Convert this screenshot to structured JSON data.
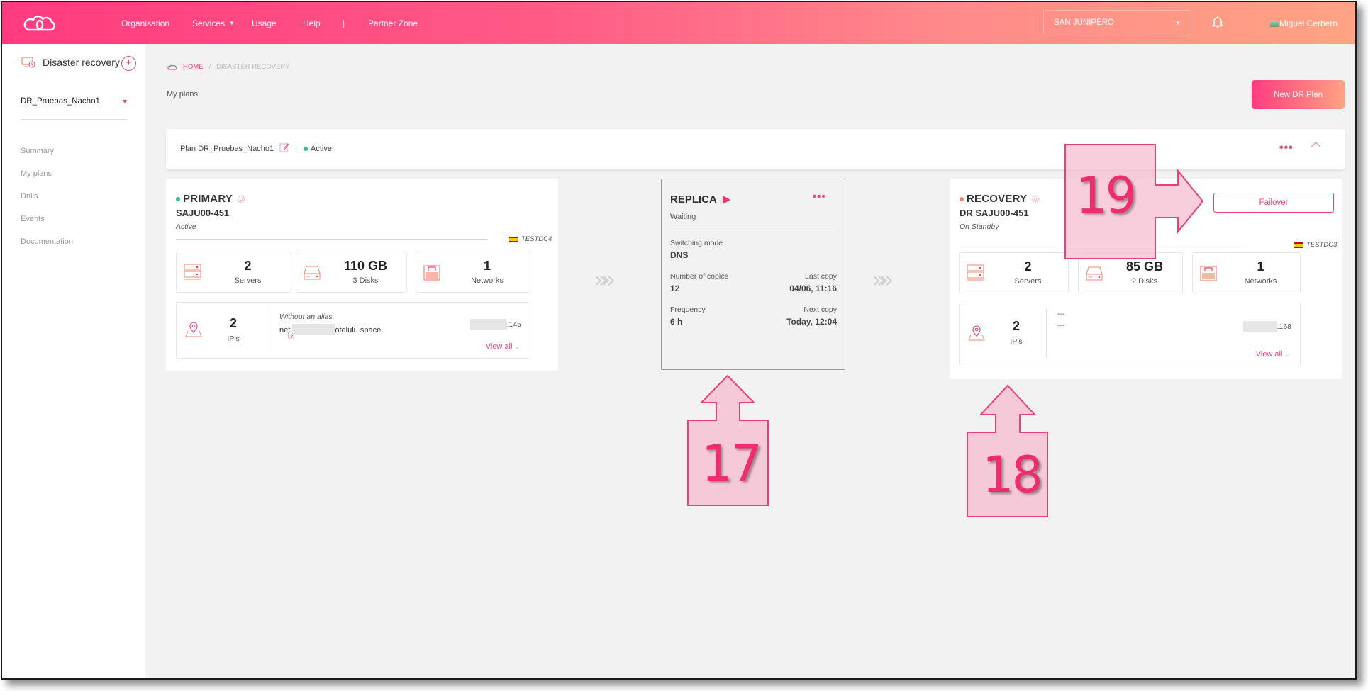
{
  "header": {
    "nav": [
      "Organisation",
      "Services",
      "Usage",
      "Help",
      "|",
      "Partner Zone"
    ],
    "region": "SAN JUNIPERO",
    "user": "Miguel Cerbern",
    "icons": {
      "logo": "cloud-logo-icon",
      "bell": "bell-icon"
    }
  },
  "sidebar": {
    "title": "Disaster recovery",
    "add_label": "+",
    "selected_plan": "DR_Pruebas_Nacho1",
    "items": [
      {
        "label": "Summary"
      },
      {
        "label": "My plans"
      },
      {
        "label": "Drills"
      },
      {
        "label": "Events"
      },
      {
        "label": "Documentation"
      }
    ]
  },
  "breadcrumb": {
    "home": "HOME",
    "separator": "/",
    "current": "DISASTER RECOVERY"
  },
  "page": {
    "subtitle": "My plans",
    "new_plan_label": "New DR Plan"
  },
  "plan": {
    "name": "Plan DR_Pruebas_Nacho1",
    "separator": "|",
    "status": "Active",
    "status_color": "#2ec27e",
    "more_label": "•••"
  },
  "primary": {
    "title": "PRIMARY",
    "status_color": "#2ec27e",
    "host": "SAJU00-451",
    "state": "Active",
    "datacenter": "TESTDC4",
    "servers": {
      "value": "2",
      "label": "Servers"
    },
    "storage": {
      "value": "110 GB",
      "label": "3 Disks"
    },
    "networks": {
      "value": "1",
      "label": "Networks"
    },
    "ips": {
      "value": "2",
      "label": "IP's"
    },
    "alias": "Without an alias",
    "hostname_prefix": "net.",
    "hostname_suffix": "otelulu.space",
    "ip_suffix": ".145",
    "view_all": "View all"
  },
  "replica": {
    "title": "REPLICA",
    "state": "Waiting",
    "more_label": "•••",
    "switching_mode_label": "Switching mode",
    "switching_mode": "DNS",
    "copies_label": "Number of copies",
    "copies": "12",
    "last_copy_label": "Last copy",
    "last_copy": "04/06, 11:16",
    "frequency_label": "Frequency",
    "frequency": "6 h",
    "next_copy_label": "Next copy",
    "next_copy": "Today, 12:04"
  },
  "recovery": {
    "title": "RECOVERY",
    "status_color": "#f5876f",
    "host": "DR SAJU00-451",
    "state": "On Standby",
    "datacenter": "TESTDC3",
    "failover_label": "Failover",
    "servers": {
      "value": "2",
      "label": "Servers"
    },
    "storage": {
      "value": "85 GB",
      "label": "2 Disks"
    },
    "networks": {
      "value": "1",
      "label": "Networks"
    },
    "ips": {
      "value": "2",
      "label": "IP's"
    },
    "alias": "---",
    "hostname": "---",
    "ip_suffix": ".168",
    "view_all": "View all"
  },
  "chevrons": "»»",
  "callouts": [
    "17",
    "18",
    "19"
  ],
  "colors": {
    "accent": "#e8417a",
    "header_start": "#ff3b7f",
    "header_end": "#ffa383",
    "callout_fill": "#f5c9d8",
    "callout_stroke": "#e8417a"
  }
}
